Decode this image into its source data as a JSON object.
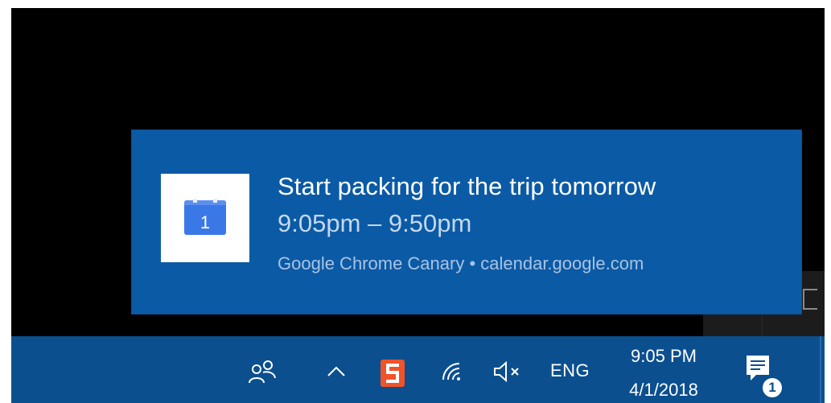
{
  "toast": {
    "title": "Start packing for the trip tomorrow",
    "time": "9:05pm – 9:50pm",
    "source": "Google Chrome Canary • calendar.google.com",
    "icon": "google-calendar-icon",
    "icon_number": "1"
  },
  "taskbar": {
    "icons": [
      "people-icon",
      "chevron-up-icon",
      "sogou-ime-icon",
      "wifi-icon",
      "volume-muted-icon",
      "action-center-icon"
    ],
    "language": "ENG",
    "clock": {
      "time": "9:05 PM",
      "date": "4/1/2018"
    },
    "notification_count": "1"
  },
  "colors": {
    "toast_bg": "#0b5aa6",
    "taskbar_bg": "#0b4f8f",
    "sogou_orange": "#f0532a",
    "calendar_blue": "#4285f4"
  }
}
